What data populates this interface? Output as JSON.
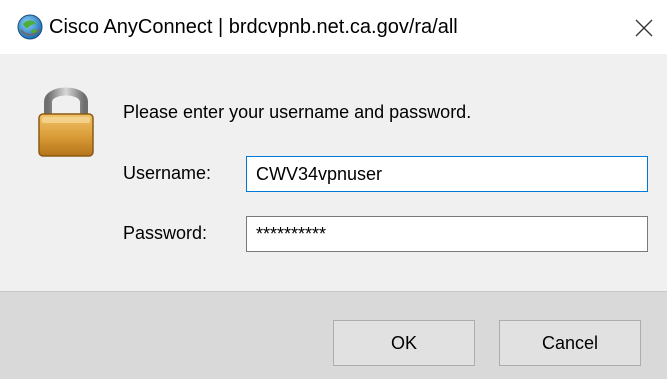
{
  "window": {
    "title": "Cisco AnyConnect | brdcvpnb.net.ca.gov/ra/all",
    "app_icon": "anyconnect-globe-icon",
    "close_icon": "close-icon"
  },
  "dialog": {
    "prompt": "Please enter your username and password.",
    "lock_icon": "lock-icon",
    "username": {
      "label": "Username:",
      "value": "CWV34vpnuser"
    },
    "password": {
      "label": "Password:",
      "value": "**********"
    }
  },
  "buttons": {
    "ok": "OK",
    "cancel": "Cancel"
  },
  "colors": {
    "accent_focus_border": "#0078d7",
    "content_background": "#f0f0f0",
    "footer_background": "#d9d9d9"
  }
}
